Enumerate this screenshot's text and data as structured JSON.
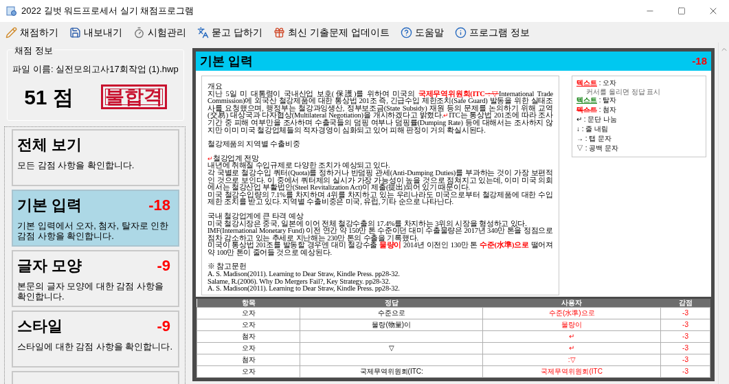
{
  "window": {
    "title": "2022 길벗 워드프로세서 실기 채점프로그램"
  },
  "menu": [
    {
      "label": "채점하기"
    },
    {
      "label": "내보내기"
    },
    {
      "label": "시험관리"
    },
    {
      "label": "묻고 답하기"
    },
    {
      "label": "최신 기출문제 업데이트"
    },
    {
      "label": "도움말"
    },
    {
      "label": "프로그램 정보"
    }
  ],
  "grading_info": {
    "title": "채점 정보",
    "file_name": "파일 이름: 실전모의고사17회작업 (1).hwp",
    "score": "51 점",
    "result": "불합격"
  },
  "categories": [
    {
      "title": "전체 보기",
      "description": "모든 감점 사항을 확인합니다.",
      "selected": false
    },
    {
      "title": "기본 입력",
      "deduction": "-18",
      "description": "기본 입력에서 오자, 첨자, 탈자로 인한 감점 사항을 확인합니다.",
      "selected": true
    },
    {
      "title": "글자 모양",
      "deduction": "-9",
      "description": "본문의 글자 모양에 대한 감점 사항을 확인합니다.",
      "selected": false
    },
    {
      "title": "스타일",
      "deduction": "-9",
      "description": "스타일에 대한 감점 사항을 확인합니다.",
      "selected": false
    }
  ],
  "section": {
    "title": "기본 입력",
    "deduction": "-18"
  },
  "document": [
    [
      [
        {
          "kind": "text",
          "text": "개요"
        }
      ],
      [
        {
          "kind": "text",
          "text": "지난 5일 미 대통령이 국내산업 보호(保護)를 위하여 미국의 "
        },
        {
          "kind": "error",
          "text": "국제무역위원회(ITC"
        },
        {
          "kind": "insert",
          "text": " :▽"
        },
        {
          "kind": "text",
          "text": "International Trade Commission)에 외국산 철강제품에 대한 통상법 201조 즉, 긴급수입 제한조치(Safe Guard) 발동을 위한 실태조사를 요청했으며, 행정부는 철강과잉생산, 정부보조금(State Subsidy) 재원 등의 문제를 논의하기 위해 교역(交易) 대상국과 다자협상(Multilateral Negotiation)을 개시하겠다고 밝혔다."
        },
        {
          "kind": "break",
          "text": "↵"
        },
        {
          "kind": "text",
          "text": "ITC는 통상법 201조에 따라 조사기간 중 피해 여부만을 조사하며 수출국들의 덤핑 여부나 덤핑률(Dumping Rate) 등에 대해서는 조사하지 않지만 이미 미국 철강업체들의 적자경영이 심화되고 있어 피해 판정이 거의 확실시된다."
        }
      ]
    ],
    [
      [
        {
          "kind": "text",
          "text": "철강제품의 지역별 수출비중"
        }
      ]
    ],
    [
      [
        {
          "kind": "break",
          "text": "↵"
        },
        {
          "kind": "text",
          "text": "철강업계 전망"
        }
      ],
      [
        {
          "kind": "text",
          "text": "내년에 취해질 수입규제로 다양한 조치가 예상되고 있다."
        }
      ],
      [
        {
          "kind": "text",
          "text": "각 국별로 철강수입 쿼터(Quota)를 정하거나 반덤핑 관세(Anti-Dumping Duties)를 부과하는 것이 가장 보편적인 것으로 보인다. 이 중에서 쿼터제의 실시가 가장 가능성이 높을 것으로 점쳐지고 있는데, 이미 미국 의회에서는 철강산업 부활법안(Steel Revitalization Act)이 제출(提出)되어 있기 때문이다."
        }
      ],
      [
        {
          "kind": "text",
          "text": "미국 철강수입량의 7.1%를 차지하며 4위를 차지하고 있는 우리나라도 미국으로부터 철강제품에 대한 수입제한 조치를 받고 있다. 지역별 수출비중은 미국, 유럽, 기타 순으로 나타난다."
        }
      ]
    ],
    [
      [
        {
          "kind": "text",
          "text": "국내 철강업계에 큰 타격 예상"
        }
      ],
      [
        {
          "kind": "text",
          "text": "미국 철강시장은 중국, 일본에 이어 전체 철강수출의 17.4%를 차지하는 3위의 시장을 형성하고 있다."
        }
      ],
      [
        {
          "kind": "text",
          "text": "IMF(International Monetary Fund) 이전 연간 약 150만 톤 수준이던 대미 수출물량은 2017년 340만 톤을 정점으로 점차 감소하고 있는 추세로 지난해는 230만 톤의 수출을 기록했다."
        }
      ],
      [
        {
          "kind": "text",
          "text": "미국이 통상법 201조를 발동할 경우엔 대미 철강수출 "
        },
        {
          "kind": "error",
          "text": "물량이"
        },
        {
          "kind": "text",
          "text": " 2014년 이전인 130만 톤 "
        },
        {
          "kind": "error",
          "text": "수준(水準)으로"
        },
        {
          "kind": "text",
          "text": " 떨어져 약 100만 톤이 줄어들 것으로 예상된다."
        }
      ]
    ],
    [
      [
        {
          "kind": "text",
          "text": "※ 참고문헌"
        }
      ],
      [
        {
          "kind": "text",
          "text": "A. S. Madison(2011). Learning to Dear Straw, Kindle Press. pp28-32."
        }
      ],
      [
        {
          "kind": "text",
          "text": "Salame, R.(2006). Why Do Mergers Fail?, Key Strategy. pp28-32."
        }
      ],
      [
        {
          "kind": "text",
          "text": "A. S. Madison(2011). Learning to Dear Straw, Kindle Press. pp28-32."
        }
      ]
    ]
  ],
  "legend": [
    {
      "kind": "error",
      "sample": "텍스트",
      "label": ": 오자",
      "note": "커서를 올리면 정답 표시"
    },
    {
      "kind": "omission",
      "sample": "텍스트",
      "label": ": 탈자"
    },
    {
      "kind": "insertion",
      "sample": "텍스트",
      "label": ": 첨자"
    },
    {
      "kind": "symbol",
      "sample": "↵",
      "label": ": 문단 나눔"
    },
    {
      "kind": "symbol",
      "sample": "↓",
      "label": ": 줄 내림"
    },
    {
      "kind": "symbol",
      "sample": "→",
      "label": ": 탭 문자"
    },
    {
      "kind": "symbol",
      "sample": "▽",
      "label": ": 공백 문자"
    }
  ],
  "table": {
    "columns": [
      "항목",
      "정답",
      "사용자",
      "감점"
    ],
    "rows": [
      [
        "오자",
        "수준으로",
        "수준(水準)으로",
        "-3"
      ],
      [
        "오자",
        "물량(物量)이",
        "물량이",
        "-3"
      ],
      [
        "첨자",
        null,
        "↵",
        "-3"
      ],
      [
        "오자",
        "▽",
        "↵",
        "-3"
      ],
      [
        "첨자",
        null,
        ":▽",
        "-3"
      ],
      [
        "오자",
        "국제무역위원회(ITC:",
        "국제무역위원회(ITC",
        "-3"
      ]
    ]
  }
}
